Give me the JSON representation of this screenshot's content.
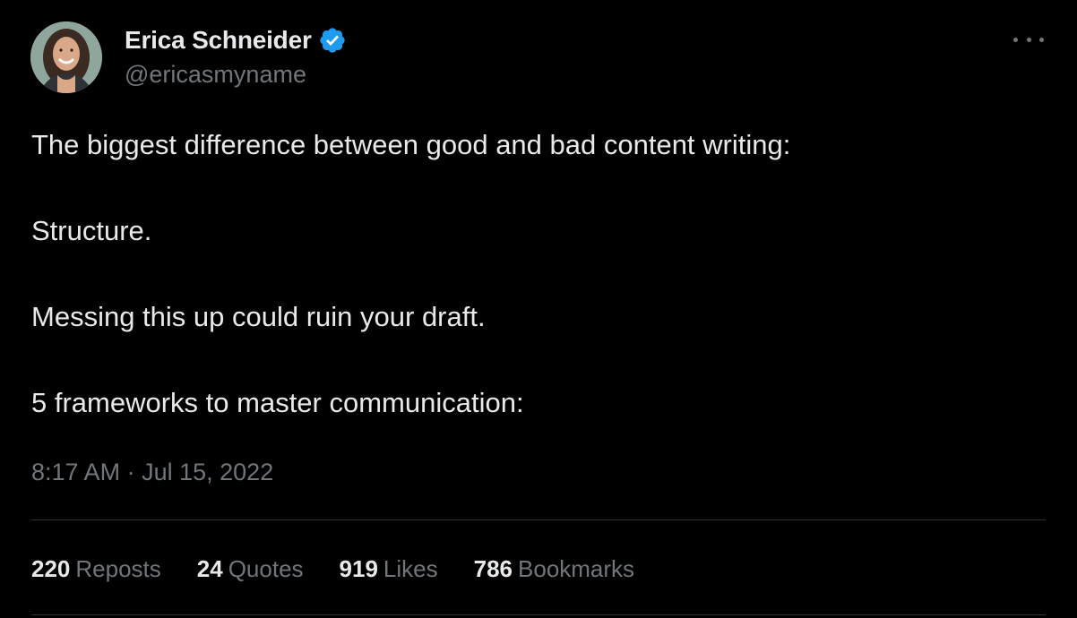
{
  "author": {
    "display_name": "Erica Schneider",
    "handle": "@ericasmyname",
    "verified": true,
    "avatar": "profile-photo",
    "verified_color": "#1d9bf0"
  },
  "menu": {
    "icon": "more-horizontal-icon"
  },
  "tweet": {
    "paragraphs": [
      "The biggest difference between good and bad content writing:",
      "Structure.",
      "Messing this up could ruin your draft.",
      "5 frameworks to master communication:"
    ],
    "time": "8:17 AM",
    "separator": "·",
    "date": "Jul 15, 2022"
  },
  "stats": [
    {
      "count": "220",
      "label": "Reposts"
    },
    {
      "count": "24",
      "label": "Quotes"
    },
    {
      "count": "919",
      "label": "Likes"
    },
    {
      "count": "786",
      "label": "Bookmarks"
    }
  ],
  "colors": {
    "background": "#000000",
    "text_primary": "#e7e9ea",
    "text_secondary": "#71767b",
    "divider": "#2f3336"
  }
}
